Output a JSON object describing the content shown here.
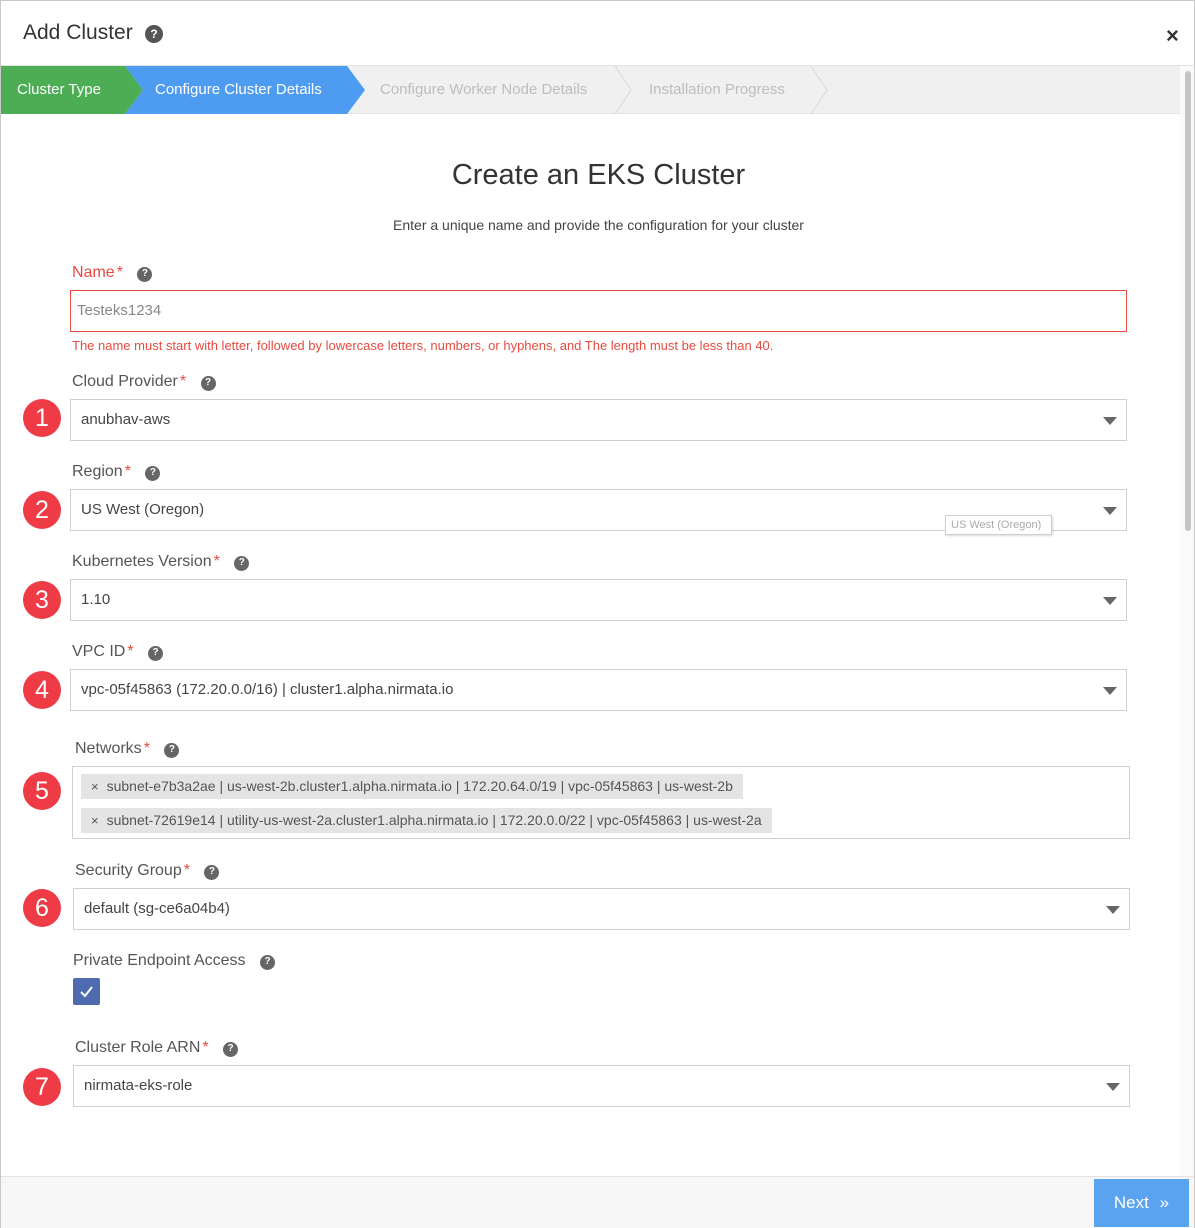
{
  "header": {
    "title": "Add Cluster",
    "close_label": "×"
  },
  "steps": [
    "Cluster Type",
    "Configure Cluster Details",
    "Configure Worker Node Details",
    "Installation Progress"
  ],
  "form": {
    "heading": "Create an EKS Cluster",
    "subheading": "Enter a unique name and provide the configuration for your cluster",
    "required_mark": "*",
    "name": {
      "label": "Name",
      "value": "Testeks1234",
      "error": "The name must start with letter, followed by lowercase letters, numbers, or hyphens, and The length must be less than 40."
    },
    "cloud_provider": {
      "label": "Cloud Provider",
      "value": "anubhav-aws"
    },
    "region": {
      "label": "Region",
      "value": "US West (Oregon)",
      "tooltip": "US West (Oregon)"
    },
    "kubernetes_version": {
      "label": "Kubernetes Version",
      "value": "1.10"
    },
    "vpc_id": {
      "label": "VPC ID",
      "value": "vpc-05f45863 (172.20.0.0/16) | cluster1.alpha.nirmata.io"
    },
    "networks": {
      "label": "Networks",
      "tags": [
        "subnet-e7b3a2ae | us-west-2b.cluster1.alpha.nirmata.io | 172.20.64.0/19 | vpc-05f45863 | us-west-2b",
        "subnet-72619e14 | utility-us-west-2a.cluster1.alpha.nirmata.io | 172.20.0.0/22 | vpc-05f45863 | us-west-2a"
      ]
    },
    "security_group": {
      "label": "Security Group",
      "value": "default (sg-ce6a04b4)"
    },
    "private_endpoint": {
      "label": "Private Endpoint Access",
      "checked": true
    },
    "cluster_role_arn": {
      "label": "Cluster Role ARN",
      "value": "nirmata-eks-role"
    }
  },
  "badges": [
    "1",
    "2",
    "3",
    "4",
    "5",
    "6",
    "7"
  ],
  "footer": {
    "next_label": "Next"
  },
  "colors": {
    "step_done": "#4cad54",
    "step_active": "#4d9cf1",
    "error": "#e84a3f",
    "badge": "#ee3b45",
    "next_button": "#5aa3f0",
    "checkbox": "#4f6bb0"
  }
}
